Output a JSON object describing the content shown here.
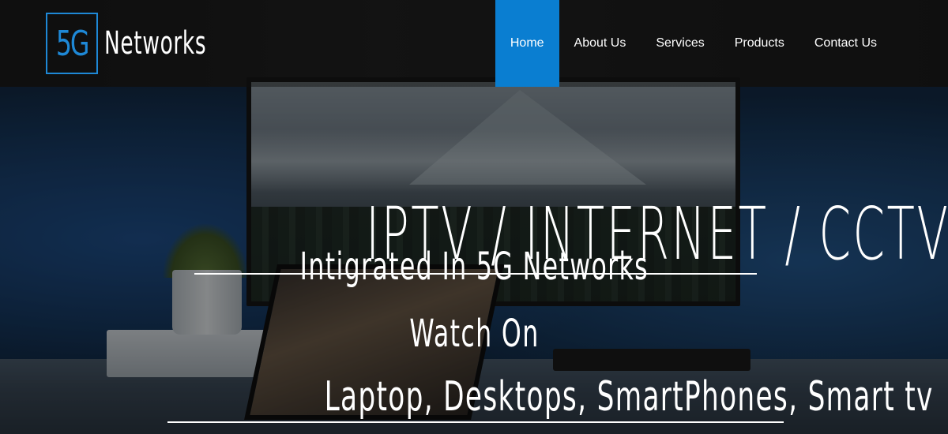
{
  "brand": {
    "logo_mark": "5G",
    "logo_text": "Networks",
    "accent_color": "#1e88d6"
  },
  "nav": {
    "items": [
      {
        "label": "Home",
        "active": true
      },
      {
        "label": "About Us",
        "active": false
      },
      {
        "label": "Services",
        "active": false
      },
      {
        "label": "Products",
        "active": false
      },
      {
        "label": "Contact Us",
        "active": false
      }
    ],
    "active_color": "#0a7ed1"
  },
  "hero": {
    "title": "IPTV / INTERNET / CCTV",
    "subtitle": "Intigrated In 5G Networks",
    "watch_label": "Watch On",
    "devices": "Laptop, Desktops, SmartPhones, Smart tv"
  }
}
